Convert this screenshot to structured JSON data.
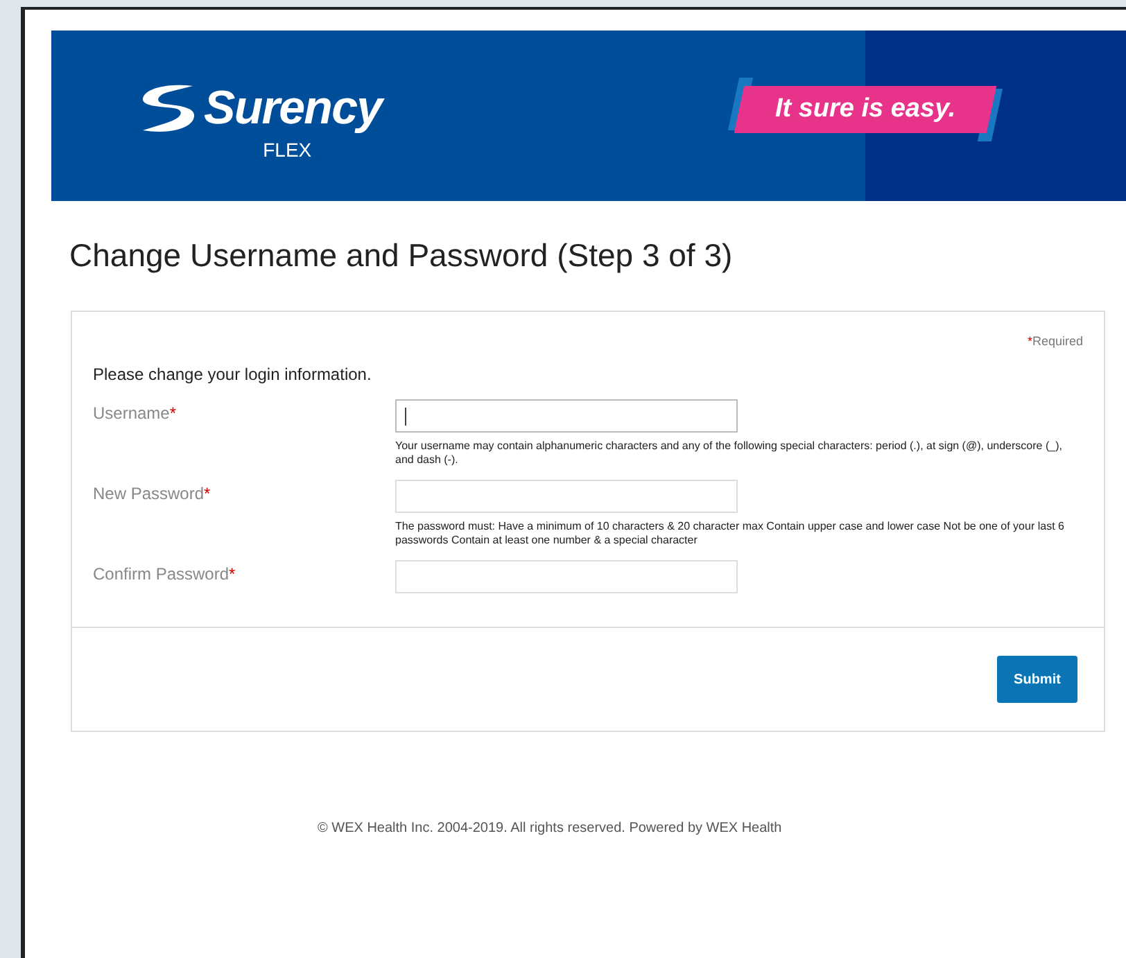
{
  "banner": {
    "brand": "Surency",
    "sub_brand": "FLEX",
    "tagline": "It sure is easy."
  },
  "title": "Change Username and Password (Step 3 of 3)",
  "form": {
    "required_note": {
      "mark": "*",
      "text": "Required"
    },
    "intro": "Please change your login information.",
    "fields": [
      {
        "label": "Username",
        "mark": "*",
        "focused": true,
        "help": "Your username may contain alphanumeric characters and any of the following special characters: period (.), at sign (@), underscore (_), and dash (-)."
      },
      {
        "label": "New Password",
        "mark": "*",
        "focused": false,
        "help": "The password must: Have a minimum of 10 characters & 20 character max Contain upper case and lower case Not be one of your last 6 passwords Contain at least one number & a special character"
      },
      {
        "label": "Confirm Password",
        "mark": "*",
        "focused": false
      }
    ],
    "submit": "Submit"
  },
  "footer": "© WEX Health Inc. 2004-2019. All rights reserved. Powered by WEX Health"
}
